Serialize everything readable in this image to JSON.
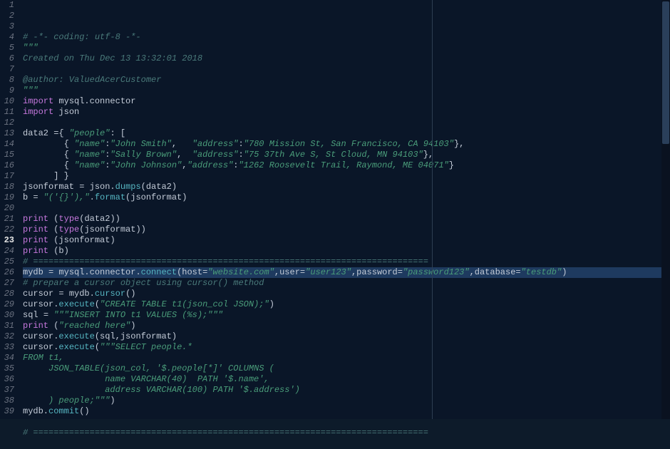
{
  "editor": {
    "current_line": 23,
    "lines": [
      {
        "n": 1,
        "tokens": [
          [
            "comment",
            "# -*- coding: utf-8 -*-"
          ]
        ]
      },
      {
        "n": 2,
        "tokens": [
          [
            "str",
            "\"\"\""
          ]
        ]
      },
      {
        "n": 3,
        "tokens": [
          [
            "comment",
            "Created on Thu Dec 13 13:32:01 2018"
          ]
        ]
      },
      {
        "n": 4,
        "tokens": []
      },
      {
        "n": 5,
        "tokens": [
          [
            "comment",
            "@author: ValuedAcerCustomer"
          ]
        ]
      },
      {
        "n": 6,
        "tokens": [
          [
            "str",
            "\"\"\""
          ]
        ]
      },
      {
        "n": 7,
        "tokens": [
          [
            "keyword",
            "import"
          ],
          [
            "ident",
            " mysql.connector"
          ]
        ]
      },
      {
        "n": 8,
        "tokens": [
          [
            "keyword",
            "import"
          ],
          [
            "ident",
            " json"
          ]
        ]
      },
      {
        "n": 9,
        "tokens": []
      },
      {
        "n": 10,
        "tokens": [
          [
            "ident",
            "data2 "
          ],
          [
            "op",
            "="
          ],
          [
            "punct",
            "{ "
          ],
          [
            "str",
            "\"people\""
          ],
          [
            "punct",
            ": ["
          ],
          [
            "punct",
            ""
          ]
        ]
      },
      {
        "n": 11,
        "tokens": [
          [
            "ident",
            "        "
          ],
          [
            "punct",
            "{ "
          ],
          [
            "str",
            "\"name\""
          ],
          [
            "punct",
            ":"
          ],
          [
            "str",
            "\"John Smith\""
          ],
          [
            "punct",
            ",   "
          ],
          [
            "str",
            "\"address\""
          ],
          [
            "punct",
            ":"
          ],
          [
            "str",
            "\"780 Mission St, San Francisco, CA 94103\""
          ],
          [
            "punct",
            "},"
          ]
        ]
      },
      {
        "n": 12,
        "tokens": [
          [
            "ident",
            "        "
          ],
          [
            "punct",
            "{ "
          ],
          [
            "str",
            "\"name\""
          ],
          [
            "punct",
            ":"
          ],
          [
            "str",
            "\"Sally Brown\""
          ],
          [
            "punct",
            ",  "
          ],
          [
            "str",
            "\"address\""
          ],
          [
            "punct",
            ":"
          ],
          [
            "str",
            "\"75 37th Ave S, St Cloud, MN 94103\""
          ],
          [
            "punct",
            "},"
          ]
        ]
      },
      {
        "n": 13,
        "tokens": [
          [
            "ident",
            "        "
          ],
          [
            "punct",
            "{ "
          ],
          [
            "str",
            "\"name\""
          ],
          [
            "punct",
            ":"
          ],
          [
            "str",
            "\"John Johnson\""
          ],
          [
            "punct",
            ","
          ],
          [
            "str",
            "\"address\""
          ],
          [
            "punct",
            ":"
          ],
          [
            "str",
            "\"1262 Roosevelt Trail, Raymond, ME 04071\""
          ],
          [
            "punct",
            "}"
          ]
        ]
      },
      {
        "n": 14,
        "tokens": [
          [
            "ident",
            "      "
          ],
          [
            "punct",
            "] }"
          ]
        ]
      },
      {
        "n": 15,
        "tokens": [
          [
            "ident",
            "jsonformat "
          ],
          [
            "op",
            "="
          ],
          [
            "ident",
            " json."
          ],
          [
            "func",
            "dumps"
          ],
          [
            "punct",
            "("
          ],
          [
            "ident",
            "data2"
          ],
          [
            "punct",
            ")"
          ]
        ]
      },
      {
        "n": 16,
        "tokens": [
          [
            "ident",
            "b "
          ],
          [
            "op",
            "="
          ],
          [
            "ident",
            " "
          ],
          [
            "str",
            "\"('{}'),\""
          ],
          [
            "punct",
            "."
          ],
          [
            "func",
            "format"
          ],
          [
            "punct",
            "("
          ],
          [
            "ident",
            "jsonformat"
          ],
          [
            "punct",
            ")"
          ]
        ]
      },
      {
        "n": 17,
        "tokens": []
      },
      {
        "n": 18,
        "tokens": [
          [
            "builtin",
            "print"
          ],
          [
            "ident",
            " "
          ],
          [
            "punct",
            "("
          ],
          [
            "builtin",
            "type"
          ],
          [
            "punct",
            "("
          ],
          [
            "ident",
            "data2"
          ],
          [
            "punct",
            "))"
          ]
        ]
      },
      {
        "n": 19,
        "tokens": [
          [
            "builtin",
            "print"
          ],
          [
            "ident",
            " "
          ],
          [
            "punct",
            "("
          ],
          [
            "builtin",
            "type"
          ],
          [
            "punct",
            "("
          ],
          [
            "ident",
            "jsonformat"
          ],
          [
            "punct",
            "))"
          ]
        ]
      },
      {
        "n": 20,
        "tokens": [
          [
            "builtin",
            "print"
          ],
          [
            "ident",
            " "
          ],
          [
            "punct",
            "("
          ],
          [
            "ident",
            "jsonformat"
          ],
          [
            "punct",
            ")"
          ]
        ]
      },
      {
        "n": 21,
        "tokens": [
          [
            "builtin",
            "print"
          ],
          [
            "ident",
            " "
          ],
          [
            "punct",
            "("
          ],
          [
            "ident",
            "b"
          ],
          [
            "punct",
            ")"
          ]
        ]
      },
      {
        "n": 22,
        "tokens": [
          [
            "comment",
            "# ============================================================================="
          ]
        ]
      },
      {
        "n": 23,
        "current": true,
        "tokens": [
          [
            "ident",
            "mydb "
          ],
          [
            "op",
            "="
          ],
          [
            "ident",
            " mysql.connector."
          ],
          [
            "func",
            "connect"
          ],
          [
            "punct",
            "("
          ],
          [
            "ident",
            "host"
          ],
          [
            "op",
            "="
          ],
          [
            "str",
            "\"website.com\""
          ],
          [
            "punct",
            ","
          ],
          [
            "ident",
            "user"
          ],
          [
            "op",
            "="
          ],
          [
            "str",
            "\"user123\""
          ],
          [
            "punct",
            ","
          ],
          [
            "ident",
            "password"
          ],
          [
            "op",
            "="
          ],
          [
            "str",
            "\"password123\""
          ],
          [
            "punct",
            ","
          ],
          [
            "ident",
            "database"
          ],
          [
            "op",
            "="
          ],
          [
            "str",
            "\"testdb\""
          ],
          [
            "punct",
            ")"
          ]
        ]
      },
      {
        "n": 24,
        "tokens": [
          [
            "comment",
            "# prepare a cursor object using cursor() method"
          ]
        ]
      },
      {
        "n": 25,
        "tokens": [
          [
            "ident",
            "cursor "
          ],
          [
            "op",
            "="
          ],
          [
            "ident",
            " mydb."
          ],
          [
            "func",
            "cursor"
          ],
          [
            "punct",
            "()"
          ]
        ]
      },
      {
        "n": 26,
        "tokens": [
          [
            "ident",
            "cursor."
          ],
          [
            "func",
            "execute"
          ],
          [
            "punct",
            "("
          ],
          [
            "str",
            "\"CREATE TABLE t1(json_col JSON);\""
          ],
          [
            "punct",
            ")"
          ]
        ]
      },
      {
        "n": 27,
        "tokens": [
          [
            "ident",
            "sql "
          ],
          [
            "op",
            "="
          ],
          [
            "ident",
            " "
          ],
          [
            "str",
            "\"\"\"INSERT INTO t1 VALUES (%s);\"\"\""
          ]
        ]
      },
      {
        "n": 28,
        "tokens": [
          [
            "builtin",
            "print"
          ],
          [
            "ident",
            " "
          ],
          [
            "punct",
            "("
          ],
          [
            "str",
            "\"reached here\""
          ],
          [
            "punct",
            ")"
          ]
        ]
      },
      {
        "n": 29,
        "tokens": [
          [
            "ident",
            "cursor."
          ],
          [
            "func",
            "execute"
          ],
          [
            "punct",
            "("
          ],
          [
            "ident",
            "sql"
          ],
          [
            "punct",
            ","
          ],
          [
            "ident",
            "jsonformat"
          ],
          [
            "punct",
            ")"
          ]
        ]
      },
      {
        "n": 30,
        "tokens": [
          [
            "ident",
            "cursor."
          ],
          [
            "func",
            "execute"
          ],
          [
            "punct",
            "("
          ],
          [
            "str",
            "\"\"\"SELECT people.*"
          ]
        ]
      },
      {
        "n": 31,
        "tokens": [
          [
            "str",
            "FROM t1,"
          ]
        ]
      },
      {
        "n": 32,
        "tokens": [
          [
            "str",
            "     JSON_TABLE(json_col, '$.people[*]' COLUMNS ("
          ]
        ]
      },
      {
        "n": 33,
        "tokens": [
          [
            "str",
            "                name VARCHAR(40)  PATH '$.name',"
          ]
        ]
      },
      {
        "n": 34,
        "tokens": [
          [
            "str",
            "                address VARCHAR(100) PATH '$.address')"
          ]
        ]
      },
      {
        "n": 35,
        "tokens": [
          [
            "str",
            "     ) people;\"\"\""
          ],
          [
            "punct",
            ")"
          ]
        ]
      },
      {
        "n": 36,
        "tokens": [
          [
            "ident",
            "mydb."
          ],
          [
            "func",
            "commit"
          ],
          [
            "punct",
            "()"
          ]
        ]
      },
      {
        "n": 37,
        "tokens": []
      },
      {
        "n": 38,
        "tokens": [
          [
            "comment",
            "# ============================================================================="
          ]
        ]
      },
      {
        "n": 39,
        "tokens": []
      }
    ]
  }
}
